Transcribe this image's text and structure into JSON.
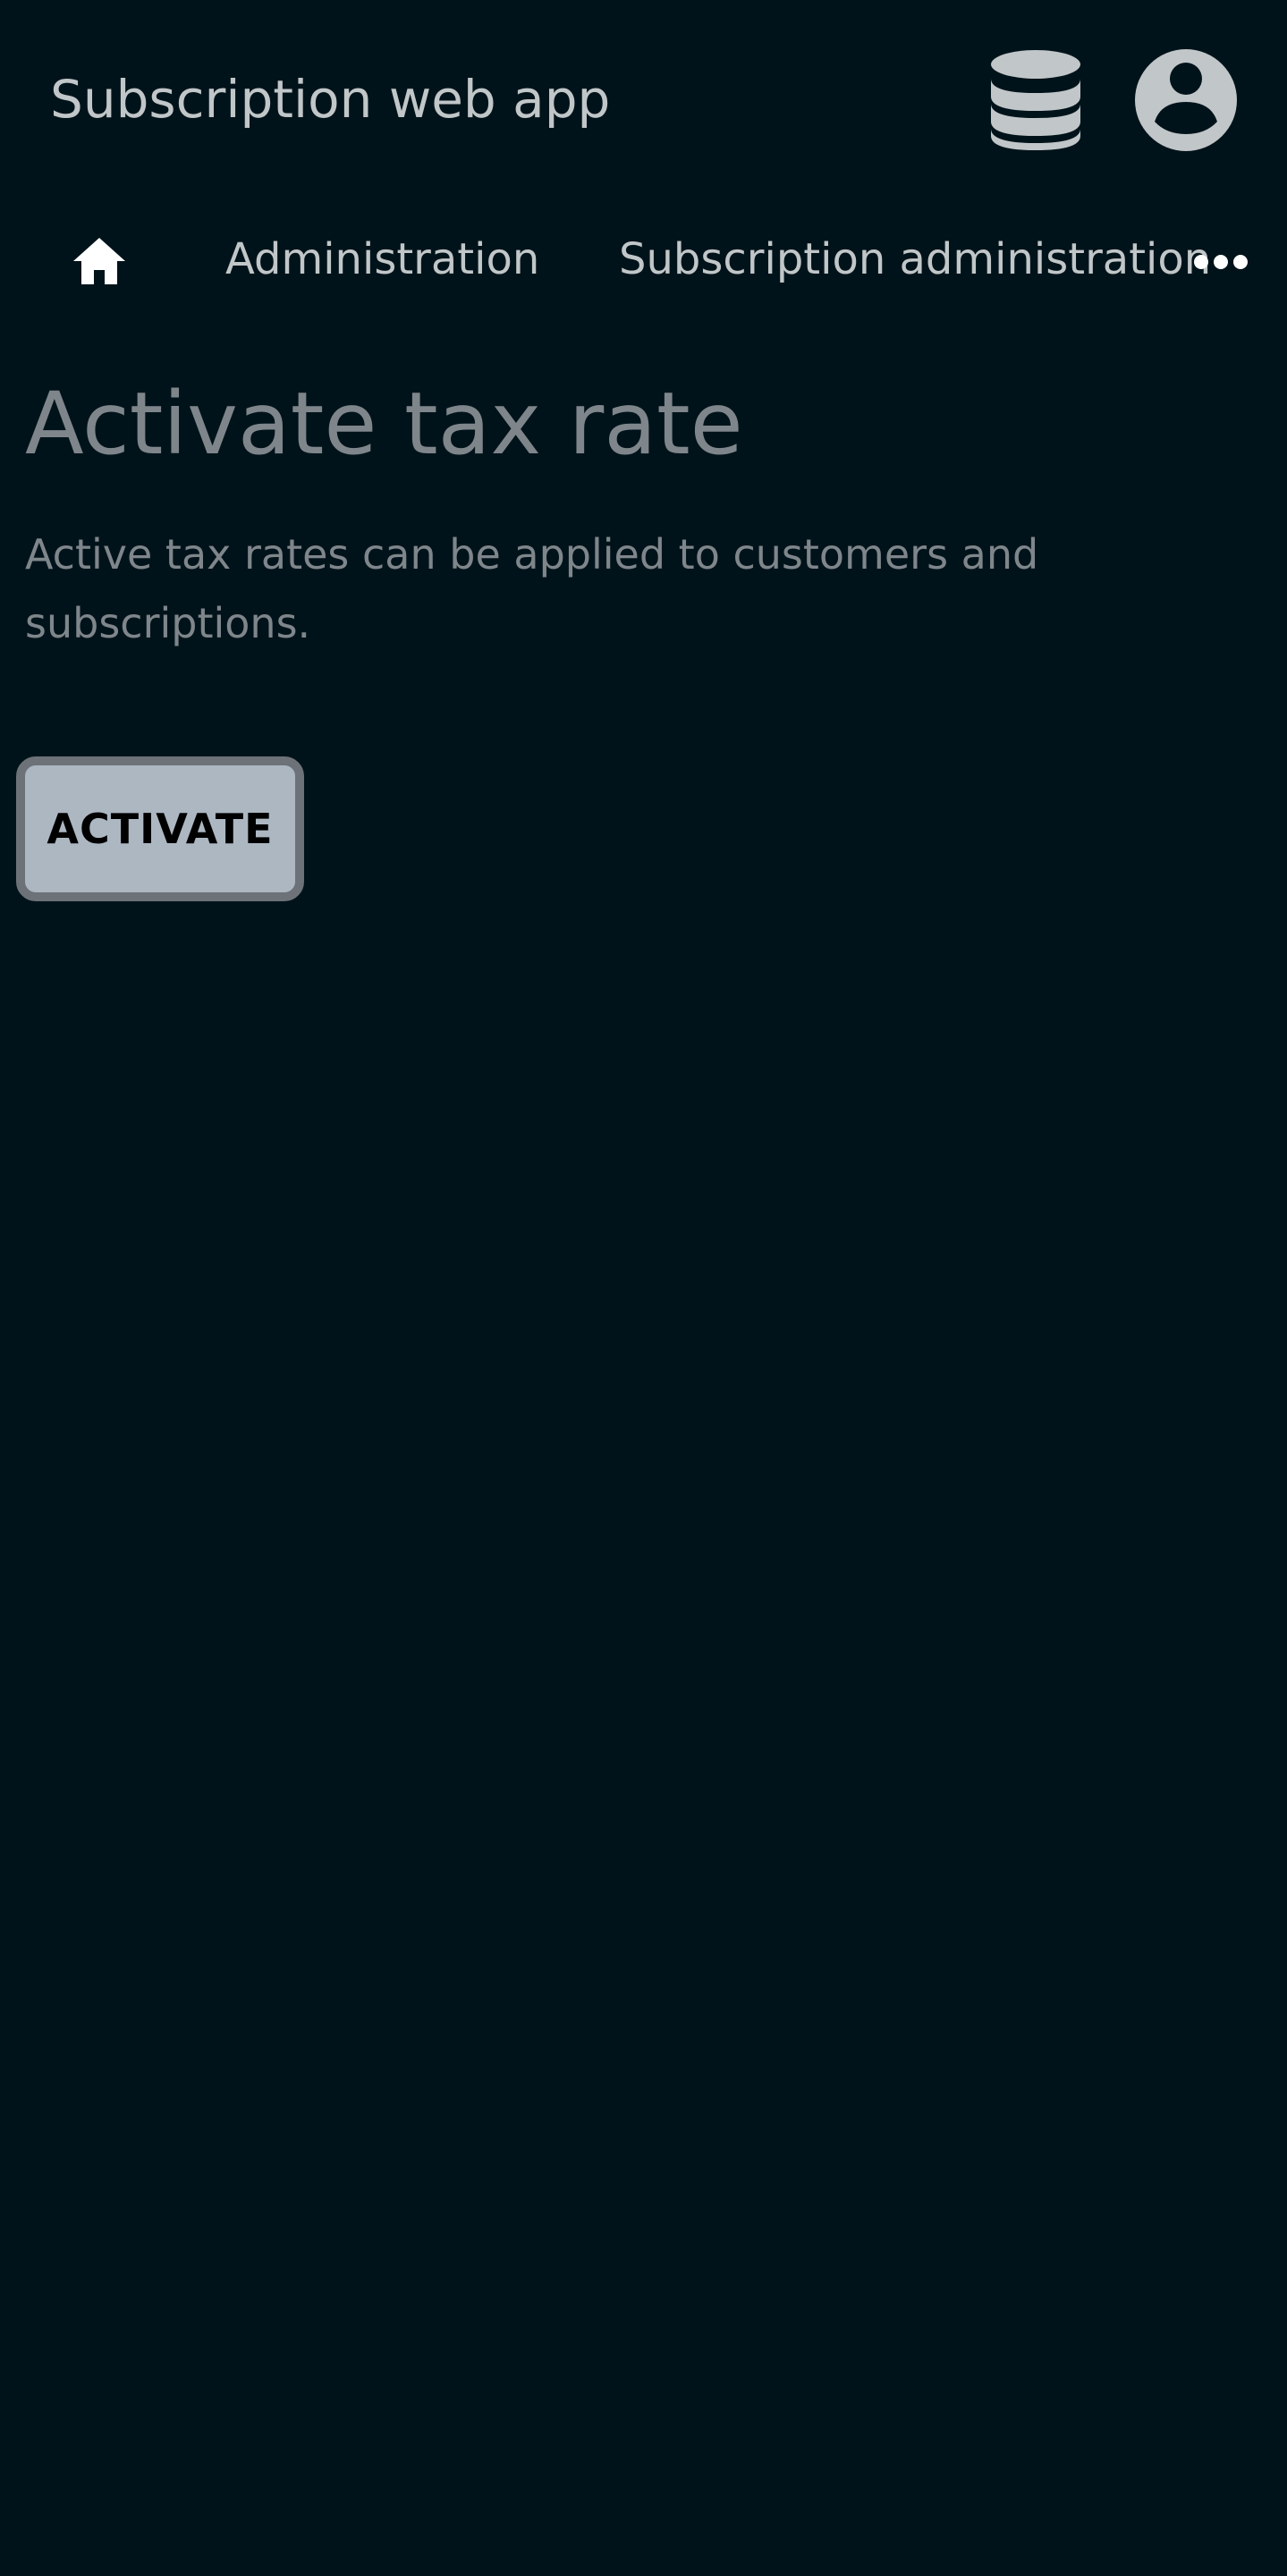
{
  "header": {
    "app_title": "Subscription web app",
    "icons": [
      "database-icon",
      "account-circle-icon"
    ]
  },
  "breadcrumb": {
    "home_icon": "home-icon",
    "items": [
      "Administration",
      "Subscription administration"
    ],
    "overflow_icon": "more-horizontal-icon"
  },
  "main": {
    "title": "Activate tax rate",
    "description": "Active tax rates can be applied to customers and subscriptions.",
    "activate_label": "ACTIVATE"
  },
  "colors": {
    "background": "#01131a",
    "header_text": "#c1c6c8",
    "muted_text": "#7f868b",
    "button_fill": "#adb7c2",
    "button_border": "#6c7278"
  }
}
